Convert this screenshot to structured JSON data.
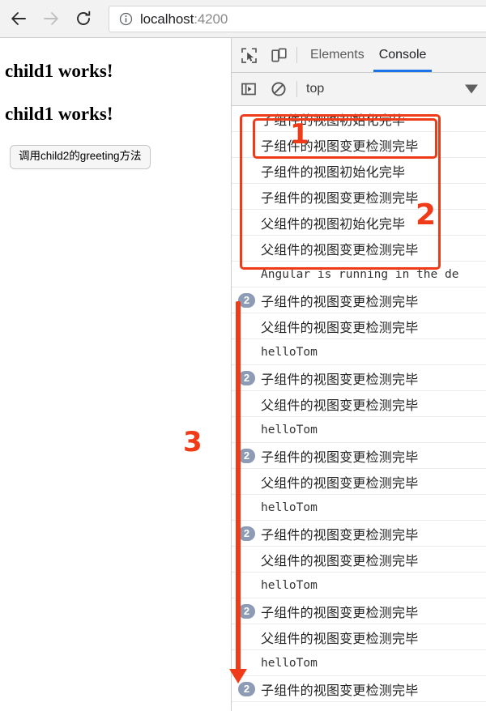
{
  "browser": {
    "back_label": "Back",
    "forward_label": "Forward",
    "reload_label": "Reload",
    "url_host": "localhost",
    "url_port": ":4200",
    "url_full": "localhost:4200",
    "info_icon": "info-circle-icon"
  },
  "page": {
    "heading_1": "child1 works!",
    "heading_2": "child1 works!",
    "button_label": "调用child2的greeting方法"
  },
  "devtools": {
    "toolbar": {
      "inspect_icon": "inspect-element-icon",
      "device_icon": "device-toolbar-icon",
      "tabs": [
        {
          "label": "Elements",
          "active": false
        },
        {
          "label": "Console",
          "active": true
        }
      ]
    },
    "filterbar": {
      "sidebar_icon": "console-sidebar-icon",
      "clear_icon": "clear-console-icon",
      "context": "top",
      "caret_icon": "chevron-down-icon"
    },
    "logs": [
      {
        "count": "",
        "text": "子组件的视图初始化完毕",
        "mono": false
      },
      {
        "count": "",
        "text": "子组件的视图变更检测完毕",
        "mono": false
      },
      {
        "count": "",
        "text": "子组件的视图初始化完毕",
        "mono": false
      },
      {
        "count": "",
        "text": "子组件的视图变更检测完毕",
        "mono": false
      },
      {
        "count": "",
        "text": "父组件的视图初始化完毕",
        "mono": false
      },
      {
        "count": "",
        "text": "父组件的视图变更检测完毕",
        "mono": false
      },
      {
        "count": "",
        "text": "Angular is running in the de",
        "mono": true
      },
      {
        "count": "2",
        "text": "子组件的视图变更检测完毕",
        "mono": false
      },
      {
        "count": "",
        "text": "父组件的视图变更检测完毕",
        "mono": false
      },
      {
        "count": "",
        "text": "helloTom",
        "mono": true
      },
      {
        "count": "2",
        "text": "子组件的视图变更检测完毕",
        "mono": false
      },
      {
        "count": "",
        "text": "父组件的视图变更检测完毕",
        "mono": false
      },
      {
        "count": "",
        "text": "helloTom",
        "mono": true
      },
      {
        "count": "2",
        "text": "子组件的视图变更检测完毕",
        "mono": false
      },
      {
        "count": "",
        "text": "父组件的视图变更检测完毕",
        "mono": false
      },
      {
        "count": "",
        "text": "helloTom",
        "mono": true
      },
      {
        "count": "2",
        "text": "子组件的视图变更检测完毕",
        "mono": false
      },
      {
        "count": "",
        "text": "父组件的视图变更检测完毕",
        "mono": false
      },
      {
        "count": "",
        "text": "helloTom",
        "mono": true
      },
      {
        "count": "2",
        "text": "子组件的视图变更检测完毕",
        "mono": false
      },
      {
        "count": "",
        "text": "父组件的视图变更检测完毕",
        "mono": false
      },
      {
        "count": "",
        "text": "helloTom",
        "mono": true
      },
      {
        "count": "2",
        "text": "子组件的视图变更检测完毕",
        "mono": false
      }
    ]
  },
  "annotations": {
    "marker_1": "1",
    "marker_2": "2",
    "marker_3": "3",
    "color": "#ef3b18"
  }
}
